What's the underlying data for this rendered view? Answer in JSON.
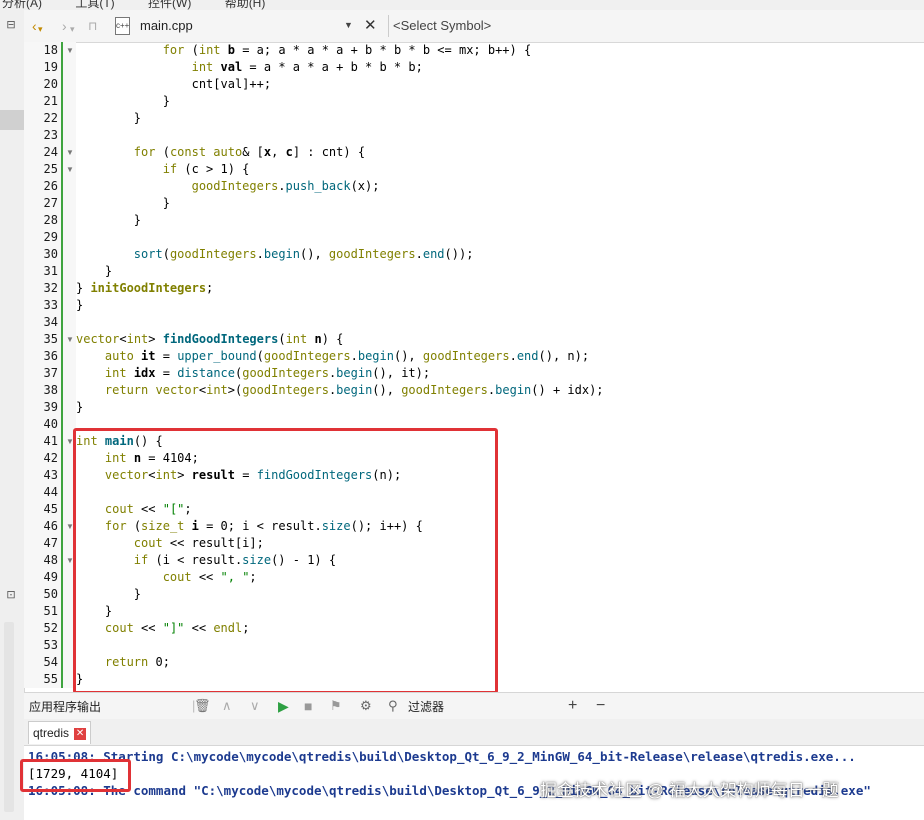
{
  "menubar": {
    "items": [
      "分析(A)",
      "工具(T)",
      "控件(W)",
      "帮助(H)"
    ]
  },
  "editor_toolbar": {
    "file_name": "main.cpp",
    "file_icon_text": "c++",
    "symbol_placeholder": "<Select Symbol>"
  },
  "editor": {
    "lines": [
      {
        "n": "18",
        "fold": true,
        "segs": [
          [
            "            ",
            ""
          ],
          [
            "for",
            "k"
          ],
          [
            " (",
            ""
          ],
          [
            "int",
            "k"
          ],
          [
            " ",
            ""
          ],
          [
            "b",
            "b"
          ],
          [
            " = a; a * a * a + b * b * b <= mx; b++) {",
            ""
          ]
        ]
      },
      {
        "n": "19",
        "fold": false,
        "segs": [
          [
            "                ",
            ""
          ],
          [
            "int",
            "k"
          ],
          [
            " ",
            ""
          ],
          [
            "val",
            "b"
          ],
          [
            " = a * a * a + b * b * b;",
            ""
          ]
        ]
      },
      {
        "n": "20",
        "fold": false,
        "segs": [
          [
            "                cnt[val]++;",
            ""
          ]
        ]
      },
      {
        "n": "21",
        "fold": false,
        "segs": [
          [
            "            }",
            ""
          ]
        ]
      },
      {
        "n": "22",
        "fold": false,
        "segs": [
          [
            "        }",
            ""
          ]
        ]
      },
      {
        "n": "23",
        "fold": false,
        "segs": [
          [
            "",
            ""
          ]
        ]
      },
      {
        "n": "24",
        "fold": true,
        "segs": [
          [
            "        ",
            ""
          ],
          [
            "for",
            "k"
          ],
          [
            " (",
            ""
          ],
          [
            "const",
            "k"
          ],
          [
            " ",
            ""
          ],
          [
            "auto",
            "k"
          ],
          [
            "& [",
            ""
          ],
          [
            "x",
            "b"
          ],
          [
            ", ",
            ""
          ],
          [
            "c",
            "b"
          ],
          [
            "] : cnt) {",
            ""
          ]
        ]
      },
      {
        "n": "25",
        "fold": true,
        "segs": [
          [
            "            ",
            ""
          ],
          [
            "if",
            "k"
          ],
          [
            " (c > 1) {",
            ""
          ]
        ]
      },
      {
        "n": "26",
        "fold": false,
        "segs": [
          [
            "                ",
            ""
          ],
          [
            "goodIntegers",
            "g"
          ],
          [
            ".",
            ""
          ],
          [
            "push_back",
            "f"
          ],
          [
            "(x);",
            ""
          ]
        ]
      },
      {
        "n": "27",
        "fold": false,
        "segs": [
          [
            "            }",
            ""
          ]
        ]
      },
      {
        "n": "28",
        "fold": false,
        "segs": [
          [
            "        }",
            ""
          ]
        ]
      },
      {
        "n": "29",
        "fold": false,
        "segs": [
          [
            "",
            ""
          ]
        ]
      },
      {
        "n": "30",
        "fold": false,
        "segs": [
          [
            "        ",
            ""
          ],
          [
            "sort",
            "f"
          ],
          [
            "(",
            ""
          ],
          [
            "goodIntegers",
            "g"
          ],
          [
            ".",
            ""
          ],
          [
            "begin",
            "f"
          ],
          [
            "(), ",
            ""
          ],
          [
            "goodIntegers",
            "g"
          ],
          [
            ".",
            ""
          ],
          [
            "end",
            "f"
          ],
          [
            "());",
            ""
          ]
        ]
      },
      {
        "n": "31",
        "fold": false,
        "segs": [
          [
            "    }",
            ""
          ]
        ]
      },
      {
        "n": "32",
        "fold": false,
        "segs": [
          [
            "} ",
            ""
          ],
          [
            "initGoodIntegers",
            "gb"
          ],
          [
            ";",
            ""
          ]
        ]
      },
      {
        "n": "33",
        "fold": false,
        "segs": [
          [
            "}",
            ""
          ]
        ]
      },
      {
        "n": "34",
        "fold": false,
        "segs": [
          [
            "",
            ""
          ]
        ]
      },
      {
        "n": "35",
        "fold": true,
        "segs": [
          [
            "vector",
            "k"
          ],
          [
            "<",
            ""
          ],
          [
            "int",
            "k"
          ],
          [
            "> ",
            ""
          ],
          [
            "findGoodIntegers",
            "fb"
          ],
          [
            "(",
            ""
          ],
          [
            "int",
            "k"
          ],
          [
            " ",
            ""
          ],
          [
            "n",
            "b"
          ],
          [
            ") {",
            ""
          ]
        ]
      },
      {
        "n": "36",
        "fold": false,
        "segs": [
          [
            "    ",
            ""
          ],
          [
            "auto",
            "k"
          ],
          [
            " ",
            ""
          ],
          [
            "it",
            "b"
          ],
          [
            " = ",
            ""
          ],
          [
            "upper_bound",
            "f"
          ],
          [
            "(",
            ""
          ],
          [
            "goodIntegers",
            "g"
          ],
          [
            ".",
            ""
          ],
          [
            "begin",
            "f"
          ],
          [
            "(), ",
            ""
          ],
          [
            "goodIntegers",
            "g"
          ],
          [
            ".",
            ""
          ],
          [
            "end",
            "f"
          ],
          [
            "(), n);",
            ""
          ]
        ]
      },
      {
        "n": "37",
        "fold": false,
        "segs": [
          [
            "    ",
            ""
          ],
          [
            "int",
            "k"
          ],
          [
            " ",
            ""
          ],
          [
            "idx",
            "b"
          ],
          [
            " = ",
            ""
          ],
          [
            "distance",
            "f"
          ],
          [
            "(",
            ""
          ],
          [
            "goodIntegers",
            "g"
          ],
          [
            ".",
            ""
          ],
          [
            "begin",
            "f"
          ],
          [
            "(), it);",
            ""
          ]
        ]
      },
      {
        "n": "38",
        "fold": false,
        "segs": [
          [
            "    ",
            ""
          ],
          [
            "return",
            "k"
          ],
          [
            " ",
            ""
          ],
          [
            "vector",
            "k"
          ],
          [
            "<",
            ""
          ],
          [
            "int",
            "k"
          ],
          [
            ">(",
            ""
          ],
          [
            "goodIntegers",
            "g"
          ],
          [
            ".",
            ""
          ],
          [
            "begin",
            "f"
          ],
          [
            "(), ",
            ""
          ],
          [
            "goodIntegers",
            "g"
          ],
          [
            ".",
            ""
          ],
          [
            "begin",
            "f"
          ],
          [
            "() + idx);",
            ""
          ]
        ]
      },
      {
        "n": "39",
        "fold": false,
        "segs": [
          [
            "}",
            ""
          ]
        ]
      },
      {
        "n": "40",
        "fold": false,
        "segs": [
          [
            "",
            ""
          ]
        ]
      },
      {
        "n": "41",
        "fold": true,
        "segs": [
          [
            "int",
            "k"
          ],
          [
            " ",
            ""
          ],
          [
            "main",
            "fb"
          ],
          [
            "() {",
            ""
          ]
        ]
      },
      {
        "n": "42",
        "fold": false,
        "segs": [
          [
            "    ",
            ""
          ],
          [
            "int",
            "k"
          ],
          [
            " ",
            ""
          ],
          [
            "n",
            "b"
          ],
          [
            " = 4104;",
            ""
          ]
        ]
      },
      {
        "n": "43",
        "fold": false,
        "segs": [
          [
            "    ",
            ""
          ],
          [
            "vector",
            "k"
          ],
          [
            "<",
            ""
          ],
          [
            "int",
            "k"
          ],
          [
            "> ",
            ""
          ],
          [
            "result",
            "b"
          ],
          [
            " = ",
            ""
          ],
          [
            "findGoodIntegers",
            "f"
          ],
          [
            "(n);",
            ""
          ]
        ]
      },
      {
        "n": "44",
        "fold": false,
        "segs": [
          [
            "",
            ""
          ]
        ]
      },
      {
        "n": "45",
        "fold": false,
        "segs": [
          [
            "    ",
            ""
          ],
          [
            "cout",
            "k"
          ],
          [
            " << ",
            ""
          ],
          [
            "\"[\"",
            "s"
          ],
          [
            ";",
            ""
          ]
        ]
      },
      {
        "n": "46",
        "fold": true,
        "segs": [
          [
            "    ",
            ""
          ],
          [
            "for",
            "k"
          ],
          [
            " (",
            ""
          ],
          [
            "size_t",
            "k"
          ],
          [
            " ",
            ""
          ],
          [
            "i",
            "b"
          ],
          [
            " = 0; i < result.",
            ""
          ],
          [
            "size",
            "f"
          ],
          [
            "(); i++) {",
            ""
          ]
        ]
      },
      {
        "n": "47",
        "fold": false,
        "segs": [
          [
            "        ",
            ""
          ],
          [
            "cout",
            "k"
          ],
          [
            " << result[i];",
            ""
          ]
        ]
      },
      {
        "n": "48",
        "fold": true,
        "segs": [
          [
            "        ",
            ""
          ],
          [
            "if",
            "k"
          ],
          [
            " (i < result.",
            ""
          ],
          [
            "size",
            "f"
          ],
          [
            "() - 1) {",
            ""
          ]
        ]
      },
      {
        "n": "49",
        "fold": false,
        "segs": [
          [
            "            ",
            ""
          ],
          [
            "cout",
            "k"
          ],
          [
            " << ",
            ""
          ],
          [
            "\", \"",
            "s"
          ],
          [
            ";",
            ""
          ]
        ]
      },
      {
        "n": "50",
        "fold": false,
        "segs": [
          [
            "        }",
            ""
          ]
        ]
      },
      {
        "n": "51",
        "fold": false,
        "segs": [
          [
            "    }",
            ""
          ]
        ]
      },
      {
        "n": "52",
        "fold": false,
        "segs": [
          [
            "    ",
            ""
          ],
          [
            "cout",
            "k"
          ],
          [
            " << ",
            ""
          ],
          [
            "\"]\"",
            "s"
          ],
          [
            " << ",
            ""
          ],
          [
            "endl",
            "k"
          ],
          [
            ";",
            ""
          ]
        ]
      },
      {
        "n": "53",
        "fold": false,
        "segs": [
          [
            "",
            ""
          ]
        ]
      },
      {
        "n": "54",
        "fold": false,
        "segs": [
          [
            "    ",
            ""
          ],
          [
            "return",
            "k"
          ],
          [
            " 0;",
            ""
          ]
        ]
      },
      {
        "n": "55",
        "fold": false,
        "segs": [
          [
            "}",
            ""
          ]
        ]
      }
    ]
  },
  "output_panel": {
    "title": "应用程序输出",
    "filter_label": "过滤器",
    "tab_label": "qtredis",
    "lines": [
      {
        "text": "16:05:08: Starting C:\\mycode\\mycode\\qtredis\\build\\Desktop_Qt_6_9_2_MinGW_64_bit-Release\\release\\qtredis.exe...",
        "color": "#1c3a8f",
        "bold": true
      },
      {
        "text": "[1729, 4104]",
        "color": "#000000",
        "bold": false
      },
      {
        "text": "16:05:08: The command \"C:\\mycode\\mycode\\qtredis\\build\\Desktop_Qt_6_9_2_MinGW_64_bit-Release\\release\\qtredis.exe\"",
        "color": "#1c3a8f",
        "bold": true
      }
    ]
  },
  "watermark": "掘金技术社区 @ 福大大架构师每日一题",
  "syntax_colors": {
    "k": "#808000",
    "f": "#00677c",
    "g": "#808000",
    "s": "#008000",
    "b": "#000000"
  },
  "highlight_color": "#e03236"
}
